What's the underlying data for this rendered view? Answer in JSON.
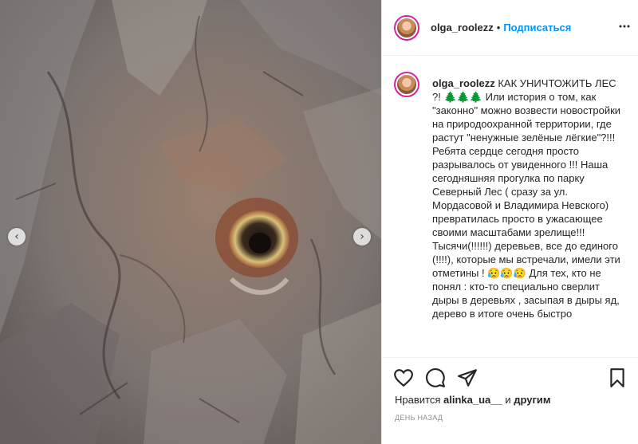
{
  "post": {
    "username": "olga_roolezz",
    "separator": "•",
    "follow_label": "Подписаться",
    "caption_username": "olga_roolezz",
    "caption_text": " КАК УНИЧТОЖИТЬ ЛЕС ?! 🌲🌲🌲 Или история о том, как \"законно\" можно возвести новостройки на природоохранной территории, где растут \"ненужные зелёные лёгкие\"?!!! Ребята сердце сегодня просто разрывалось от увиденного !!! Наша сегодняшняя прогулка по парку Северный Лес ( сразу за ул. Мордасовой и Владимира Невского) превратилась просто в ужасающее своими масштабами зрелище!!! Тысячи(!!!!!!) деревьев, все до единого (!!!!), которые мы встречали, имели эти отметины ! 😥😥😥 Для тех, кто не понял : кто-то специально сверлит дыры в деревьях , засыпая в дыры яд, дерево в итоге очень быстро",
    "likes_prefix": "Нравится ",
    "liked_by": "alinka_ua__",
    "likes_and": " и ",
    "likes_others": "другим",
    "time_ago": "день назад"
  },
  "icons": [
    "more-icon",
    "heart-icon",
    "comment-icon",
    "share-icon",
    "bookmark-icon",
    "chevron-left-icon",
    "chevron-right-icon"
  ],
  "colors": {
    "follow": "#0095f6",
    "text": "#262626",
    "muted": "#8e8e8e",
    "story_ring": "#d6249f"
  }
}
